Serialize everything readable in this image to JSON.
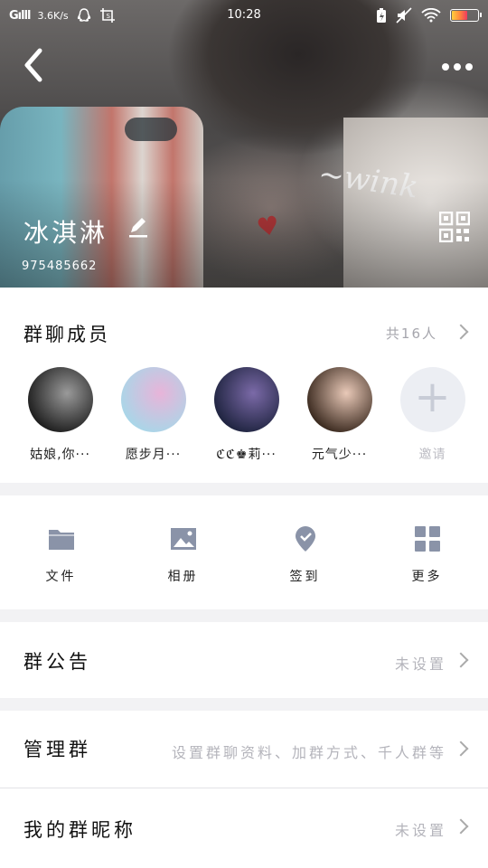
{
  "status_bar": {
    "signal": "Gılll",
    "network_speed": "3.6K/s",
    "time": "10:28",
    "battery_level_percent": 60
  },
  "header": {
    "group_name": "冰淇淋",
    "group_id": "975485662",
    "photo_caption": "~wink",
    "heart": "♥",
    "back_glyph": "‹",
    "more_glyph": "•••",
    "icons": [
      "back-icon",
      "more-icon",
      "edit-icon",
      "qr-code-icon"
    ]
  },
  "members": {
    "title": "群聊成员",
    "count": "共16人",
    "list": [
      {
        "name": "姑娘,你···",
        "colors": [
          "#1e1e1e",
          "#9a9a9a"
        ]
      },
      {
        "name": "愿步月···",
        "colors": [
          "#a9d6e8",
          "#e8b4d9"
        ]
      },
      {
        "name": "ℭℭ♚莉···",
        "colors": [
          "#1f2440",
          "#7b6aa8"
        ]
      },
      {
        "name": "元气少···",
        "colors": [
          "#3b2a1f",
          "#e9c9b8"
        ]
      }
    ],
    "invite": {
      "label": "邀请",
      "glyph": "+"
    }
  },
  "tools": [
    {
      "label": "文件",
      "icon": "folder-icon"
    },
    {
      "label": "相册",
      "icon": "image-icon"
    },
    {
      "label": "签到",
      "icon": "checkin-icon"
    },
    {
      "label": "更多",
      "icon": "grid-icon"
    }
  ],
  "rows": {
    "notice": {
      "title": "群公告",
      "value": "未设置"
    },
    "manage": {
      "title": "管理群",
      "value": "设置群聊资料、加群方式、千人群等"
    },
    "nickname": {
      "title": "我的群昵称",
      "value": "未设置"
    }
  },
  "colors": {
    "icon_gray": "#8a93a8",
    "muted_text": "#b4b4bb",
    "background": "#f2f2f4"
  }
}
